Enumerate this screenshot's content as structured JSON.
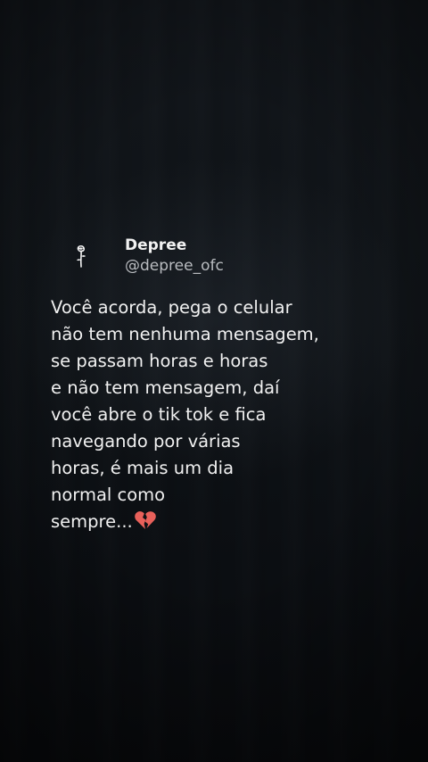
{
  "profile": {
    "display_name": "Depree",
    "handle": "@depree_ofc",
    "avatar_icon": "rose-icon"
  },
  "post": {
    "lines": [
      "Você acorda, pega o celular",
      "não tem nenhuma mensagem,",
      "se passam horas e horas",
      "e não tem mensagem, daí",
      "você abre o tik tok e fica",
      "navegando por várias",
      "horas, é mais um dia",
      "normal como",
      "sempre..."
    ],
    "end_emoji": "broken-heart-icon",
    "colors": {
      "text": "#f1f1f1",
      "handle": "#b9bcc0",
      "heart": "#e8605a"
    }
  }
}
